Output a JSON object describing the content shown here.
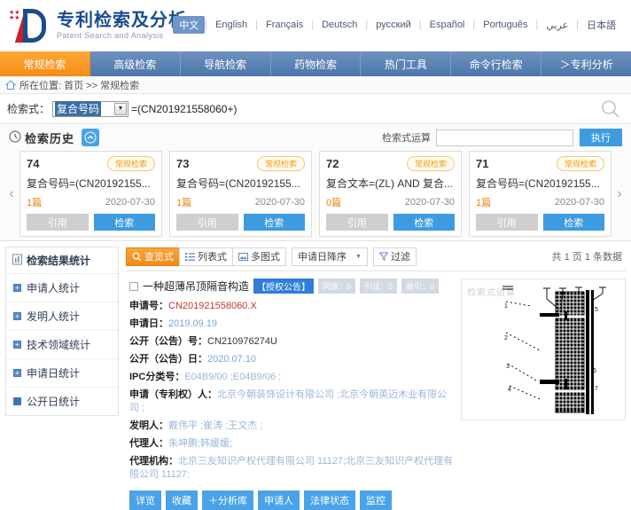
{
  "header": {
    "logo_title": "专利检索及分析",
    "logo_sub": "Patent Search and Analysis",
    "languages": [
      {
        "label": "中文",
        "active": true
      },
      {
        "label": "English",
        "active": false
      },
      {
        "label": "Français",
        "active": false
      },
      {
        "label": "Deutsch",
        "active": false
      },
      {
        "label": "русский",
        "active": false
      },
      {
        "label": "Español",
        "active": false
      },
      {
        "label": "Português",
        "active": false
      },
      {
        "label": "عربي",
        "active": false
      },
      {
        "label": "日本語",
        "active": false
      }
    ]
  },
  "nav": {
    "items": [
      {
        "label": "常规检索",
        "active": true
      },
      {
        "label": "高级检索",
        "active": false
      },
      {
        "label": "导航检索",
        "active": false
      },
      {
        "label": "药物检索",
        "active": false
      },
      {
        "label": "热门工具",
        "active": false
      },
      {
        "label": "命令行检索",
        "active": false
      },
      {
        "label": "＞专利分析",
        "active": false
      }
    ]
  },
  "breadcrumb": {
    "prefix": "所在位置:",
    "items": [
      "首页",
      "常规检索"
    ],
    "separator": ">>",
    "text": "所在位置: 首页 >> 常规检索"
  },
  "searchbar": {
    "label": "检索式：",
    "field_selected": "复合号码",
    "expression": "=(CN201921558060+)",
    "search_icon": "search-icon"
  },
  "history": {
    "title": "检索历史",
    "clock_icon": "clock-icon",
    "collapse_icon": "chevron-up-icon",
    "operator_label": "检索式运算",
    "operator_value": "",
    "exec_label": "执行",
    "prev_icon": "chevron-left-icon",
    "next_icon": "chevron-right-icon",
    "cards": [
      {
        "no": "74",
        "tag": "常规检索",
        "expr": "复合号码=(CN20192155...",
        "count": "1篇",
        "date": "2020-07-30",
        "btn_cite": "引用",
        "btn_search": "检索"
      },
      {
        "no": "73",
        "tag": "常规检索",
        "expr": "复合号码=(CN20192155...",
        "count": "1篇",
        "date": "2020-07-30",
        "btn_cite": "引用",
        "btn_search": "检索"
      },
      {
        "no": "72",
        "tag": "常规检索",
        "expr": "复合文本=(ZL) AND 复合...",
        "count": "0篇",
        "date": "2020-07-30",
        "btn_cite": "引用",
        "btn_search": "检索"
      },
      {
        "no": "71",
        "tag": "常规检索",
        "expr": "复合号码=(CN20192155...",
        "count": "1篇",
        "date": "2020-07-30",
        "btn_cite": "引用",
        "btn_search": "检索"
      }
    ]
  },
  "sidebar": {
    "title": "检索结果统计",
    "title_icon": "chart-icon",
    "items": [
      {
        "label": "申请人统计",
        "icon": "plus-box-icon",
        "expanded": false
      },
      {
        "label": "发明人统计",
        "icon": "plus-box-icon",
        "expanded": false
      },
      {
        "label": "技术领域统计",
        "icon": "plus-box-icon",
        "expanded": false
      },
      {
        "label": "申请日统计",
        "icon": "plus-box-icon",
        "expanded": false
      },
      {
        "label": "公开日统计",
        "icon": "solid-box-icon",
        "expanded": false
      }
    ]
  },
  "toolbar": {
    "view_modes": [
      {
        "label": "查览式",
        "icon": "magnifier-icon",
        "active": true
      },
      {
        "label": "列表式",
        "icon": "list-icon",
        "active": false
      },
      {
        "label": "多图式",
        "icon": "image-grid-icon",
        "active": false
      }
    ],
    "sort_value": "申请日降序",
    "sort_caret_icon": "chevron-down-icon",
    "filter_label": "过滤",
    "filter_icon": "funnel-icon",
    "count_text": "共 1 页 1 条数据"
  },
  "result": {
    "checkbox_checked": false,
    "title": "一种超薄吊顶隔音构造",
    "status_badge": "【授权公告】",
    "badges": [
      {
        "label": "同族：0"
      },
      {
        "label": "引证：0"
      },
      {
        "label": "被引：0"
      }
    ],
    "fields": [
      {
        "key": "申请号：",
        "value": "CN201921558060.X",
        "style": "red"
      },
      {
        "key": "申请日：",
        "value": "2019.09.19",
        "style": "blue"
      },
      {
        "key": "公开（公告）号：",
        "value": "CN210976274U",
        "style": "plain"
      },
      {
        "key": "公开（公告）日：",
        "value": "2020.07.10",
        "style": "blue"
      },
      {
        "key": "IPC分类号：",
        "value": "E04B9/00 ;E04B9/06 ;",
        "style": "lblue"
      },
      {
        "key": "申请（专利权）人：",
        "value": "北京今朝装饰设计有限公司 ;北京今朝英迈木业有限公司 ;",
        "style": "lblue"
      },
      {
        "key": "发明人：",
        "value": "戴伟平 ;崔涛 ;王文杰 ;",
        "style": "lblue"
      },
      {
        "key": "代理人：",
        "value": "朱坤鹏;韩媛媛;",
        "style": "lblue"
      },
      {
        "key": "代理机构：",
        "value": "北京三友知识产权代理有限公司 11127;北京三友知识产权代理有限公司 11127;",
        "style": "lblue"
      }
    ],
    "actions": [
      "详览",
      "收藏",
      "＋分析库",
      "申请人",
      "法律状态",
      "监控"
    ],
    "thumbnail_watermark": "检索式运算",
    "thumbnail_alt": "patent-drawing"
  },
  "colors": {
    "nav_active": "#f58b16",
    "brand_blue": "#1b4b8f",
    "accent_blue": "#3d9be0",
    "tag_orange": "#f39c12"
  }
}
